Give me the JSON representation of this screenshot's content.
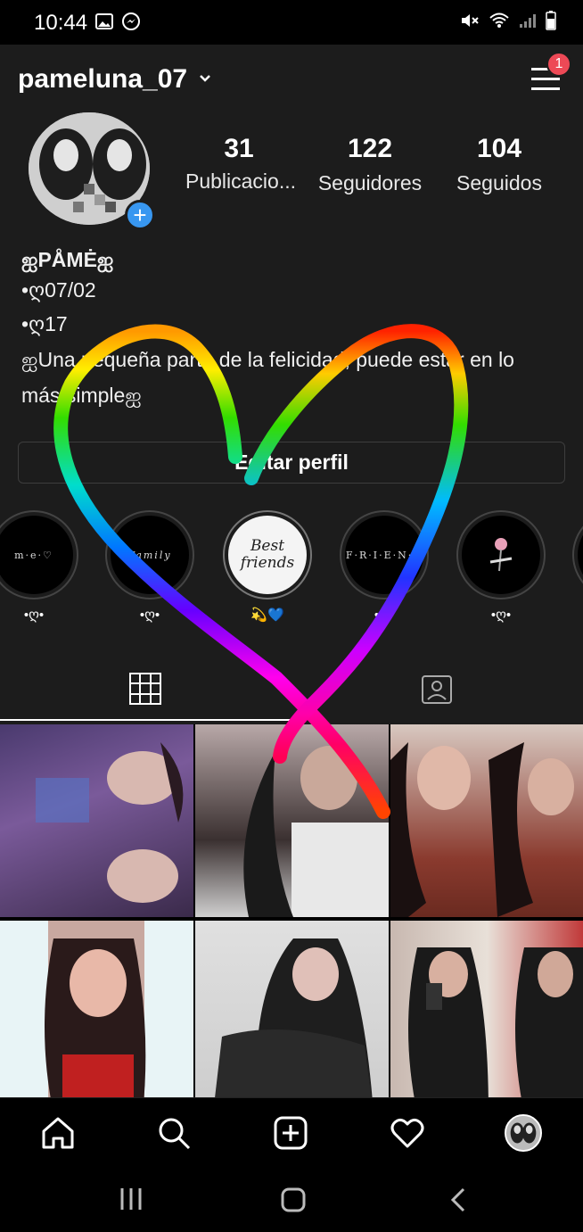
{
  "status_bar": {
    "time": "10:44"
  },
  "header": {
    "username": "pameluna_07",
    "notification_count": "1"
  },
  "stats": [
    {
      "value": "31",
      "label": "Publicacio..."
    },
    {
      "value": "122",
      "label": "Seguidores"
    },
    {
      "value": "104",
      "label": "Seguidos"
    }
  ],
  "bio": {
    "name": "ஐPÅMĖஐ",
    "line1": "•ღ07/02",
    "line2": "•ღ17",
    "line3": "ஐUna pequeña parte de la felicidad, puede estar en lo",
    "line4": "más simpleஐ"
  },
  "edit_profile_label": "Editar perfil",
  "highlights": [
    {
      "cover_text": "m·e·♡",
      "caption": "•ღ•"
    },
    {
      "cover_text": "Family",
      "caption": "•ღ•"
    },
    {
      "cover_text": "Best friends",
      "caption": "💫💙"
    },
    {
      "cover_text": "F·R·I·E·N·D",
      "caption": "•ღ•"
    },
    {
      "cover_text": "",
      "caption": "•ღ•"
    }
  ],
  "tabs": [
    "grid-icon",
    "tagged-icon"
  ],
  "bottom_nav": [
    "home-icon",
    "search-icon",
    "new-post-icon",
    "activity-heart-icon",
    "profile-avatar"
  ],
  "colors": {
    "background": "#1c1c1c",
    "accent_blue": "#3897f0",
    "badge_red": "#ed4956"
  }
}
